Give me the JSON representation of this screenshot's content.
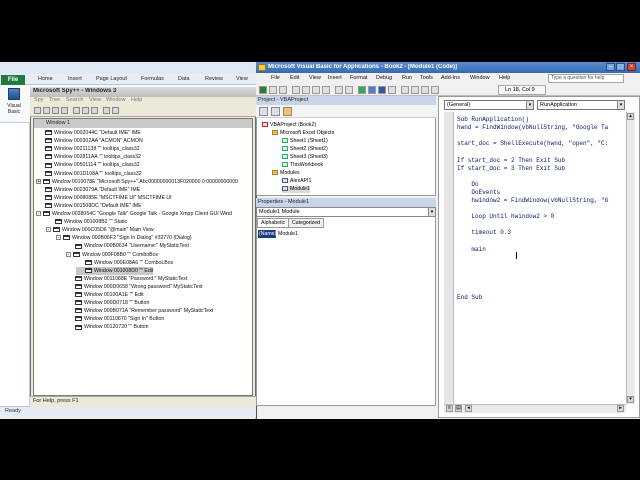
{
  "excel": {
    "file_tab": "File",
    "tabs": [
      "Home",
      "Insert",
      "Page Layout",
      "Formulas",
      "Data",
      "Review",
      "View"
    ],
    "visual_basic_label": "Visual Basic",
    "status": "Ready"
  },
  "spy": {
    "title": "Microsoft Spy++ - Windows 3",
    "menu": [
      "Spy",
      "Tree",
      "Search",
      "View",
      "Window",
      "Help"
    ],
    "tree_header": "Window 1",
    "rows": [
      {
        "indent": 0,
        "expand": "",
        "text": "Window 0002044C \"Default IME\" IME",
        "selected": false
      },
      {
        "indent": 0,
        "expand": "",
        "text": "Window 000302AA \"ACMON\" ACMON",
        "selected": false
      },
      {
        "indent": 0,
        "expand": "",
        "text": "Window 00211138 \"\" tooltips_class32",
        "selected": false
      },
      {
        "indent": 0,
        "expand": "",
        "text": "Window 002811AA \"\" tooltips_class32",
        "selected": false
      },
      {
        "indent": 0,
        "expand": "",
        "text": "Window 00501114 \"\" tooltips_class32",
        "selected": false
      },
      {
        "indent": 0,
        "expand": "",
        "text": "Window 001D108A \"\" tooltips_class32",
        "selected": false
      },
      {
        "indent": 0,
        "expand": "+",
        "text": "Window 0010078E \"Microsoft Spy++\" Afx:00000000013F020000 0:00000000000",
        "selected": false
      },
      {
        "indent": 0,
        "expand": "",
        "text": "Window 0023079A \"Default IME\" IME",
        "selected": false
      },
      {
        "indent": 0,
        "expand": "",
        "text": "Window 0008085E \"MSCTFIME UI\" MSCTFIME UI",
        "selected": false
      },
      {
        "indent": 0,
        "expand": "",
        "text": "Window 001508DC \"Default IME\" IME",
        "selected": false
      },
      {
        "indent": 0,
        "expand": "-",
        "text": "Window 0038054C \"Google Talk\" Google Talk - Google Xmpp Client GUI Wind",
        "selected": false
      },
      {
        "indent": 1,
        "expand": "",
        "text": "Window 001008B2 \"\" Static",
        "selected": false
      },
      {
        "indent": 1,
        "expand": "-",
        "text": "Window 000C05D6 \"@main\" Main View",
        "selected": false
      },
      {
        "indent": 2,
        "expand": "-",
        "text": "Window 000B06F2 \"Sign In Dialog\" #32770 (Dialog)",
        "selected": false
      },
      {
        "indent": 3,
        "expand": "",
        "text": "Window 000B0634 \"Username:\" MyStaticText",
        "selected": false
      },
      {
        "indent": 3,
        "expand": "-",
        "text": "Window 000F08B0 \"\" ComboBox",
        "selected": false
      },
      {
        "indent": 4,
        "expand": "",
        "text": "Window 000E08A6 \"\" ComboLBox",
        "selected": false
      },
      {
        "indent": 4,
        "expand": "",
        "text": "Window 001008D0 \"\" Edit",
        "selected": true
      },
      {
        "indent": 3,
        "expand": "",
        "text": "Window 0011088E \"Password:\" MyStaticText",
        "selected": false
      },
      {
        "indent": 3,
        "expand": "",
        "text": "Window 000D0658 \"Wrong password\" MyStaticText",
        "selected": false
      },
      {
        "indent": 3,
        "expand": "",
        "text": "Window 00100A1E \"\" Edit",
        "selected": false
      },
      {
        "indent": 3,
        "expand": "",
        "text": "Window 000D0718 \"\" Button",
        "selected": false
      },
      {
        "indent": 3,
        "expand": "",
        "text": "Window 000B071A \"Remember password\" MyStaticText",
        "selected": false
      },
      {
        "indent": 3,
        "expand": "",
        "text": "Window 00110870 \"Sign In\" Button",
        "selected": false
      },
      {
        "indent": 3,
        "expand": "",
        "text": "Window 00120720 \"\" Button",
        "selected": false
      }
    ],
    "status": "For Help, press F1"
  },
  "vba": {
    "title": "Microsoft Visual Basic for Applications - Book2 - [Module1 (Code)]",
    "menu": [
      "File",
      "Edit",
      "View",
      "Insert",
      "Format",
      "Debug",
      "Run",
      "Tools",
      "Add-Ins",
      "Window",
      "Help"
    ],
    "help_placeholder": "Type a question for help",
    "cursor_pos": "Ln 18, Col 9",
    "project": {
      "title": "Project - VBAProject",
      "items": [
        {
          "indent": 0,
          "icon": "proj",
          "text": "VBAProject (Book2)",
          "selected": false
        },
        {
          "indent": 1,
          "icon": "folder",
          "text": "Microsoft Excel Objects",
          "selected": false
        },
        {
          "indent": 2,
          "icon": "sheet",
          "text": "Sheet1 (Sheet1)",
          "selected": false
        },
        {
          "indent": 2,
          "icon": "sheet",
          "text": "Sheet2 (Sheet2)",
          "selected": false
        },
        {
          "indent": 2,
          "icon": "sheet",
          "text": "Sheet3 (Sheet3)",
          "selected": false
        },
        {
          "indent": 2,
          "icon": "sheet",
          "text": "ThisWorkbook",
          "selected": false
        },
        {
          "indent": 1,
          "icon": "folder",
          "text": "Modules",
          "selected": false
        },
        {
          "indent": 2,
          "icon": "module",
          "text": "AlexAPI1",
          "selected": false
        },
        {
          "indent": 2,
          "icon": "module",
          "text": "Module1",
          "selected": true
        }
      ]
    },
    "properties": {
      "title": "Properties - Module1",
      "combo": "Module1 Module",
      "tab_alpha": "Alphabetic",
      "tab_cat": "Categorized",
      "key": "(Name)",
      "value": "Module1"
    },
    "code": {
      "combo_left": "(General)",
      "combo_right": "RunApplication",
      "lines": [
        "Sub RunApplication()",
        "hwnd = FindWindow(vbNullString, \"Google Ta",
        "",
        "start_doc = ShellExecute(hwnd, \"open\", \"C:",
        "",
        "If start_doc = 2 Then Exit Sub",
        "If start_doc = 3 Then Exit Sub",
        "",
        "    Do",
        "    DoEvents",
        "    hwindow2 = FindWindow(vbNullString, \"G",
        "",
        "    Loop Until hwindow2 > 0",
        "",
        "    timeout 0.3",
        "",
        "    main",
        "",
        "",
        "",
        "",
        "",
        "End Sub"
      ]
    }
  }
}
